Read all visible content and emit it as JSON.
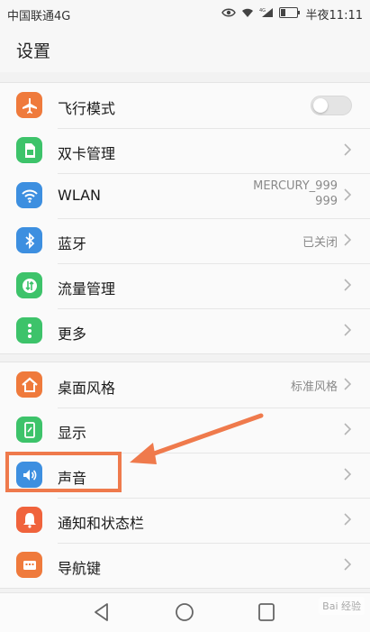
{
  "status_bar": {
    "carrier": "中国联通4G",
    "network": "4G",
    "time": "半夜11:11"
  },
  "header": {
    "title": "设置"
  },
  "groups": [
    {
      "items": [
        {
          "label": "飞行模式",
          "icon": "airplane-icon",
          "icon_color": "#ef7a3c",
          "control": "toggle",
          "toggle_on": false
        },
        {
          "label": "双卡管理",
          "icon": "sim-card-icon",
          "icon_color": "#3dc36a",
          "control": "chevron"
        },
        {
          "label": "WLAN",
          "icon": "wifi-icon",
          "icon_color": "#3d8fe0",
          "value_lines": [
            "MERCURY_999",
            "999"
          ],
          "control": "chevron"
        },
        {
          "label": "蓝牙",
          "icon": "bluetooth-icon",
          "icon_color": "#3d8fe0",
          "value": "已关闭",
          "control": "chevron"
        },
        {
          "label": "流量管理",
          "icon": "data-traffic-icon",
          "icon_color": "#3dc36a",
          "control": "chevron"
        },
        {
          "label": "更多",
          "icon": "more-dots-icon",
          "icon_color": "#3dc36a",
          "control": "chevron"
        }
      ]
    },
    {
      "items": [
        {
          "label": "桌面风格",
          "icon": "home-style-icon",
          "icon_color": "#ef7a3c",
          "value": "标准风格",
          "control": "chevron"
        },
        {
          "label": "显示",
          "icon": "display-icon",
          "icon_color": "#3dc36a",
          "control": "chevron"
        },
        {
          "label": "声音",
          "icon": "sound-icon",
          "icon_color": "#3d8fe0",
          "control": "chevron",
          "highlighted": true
        },
        {
          "label": "通知和状态栏",
          "icon": "bell-icon",
          "icon_color": "#f0633c",
          "control": "chevron"
        },
        {
          "label": "导航键",
          "icon": "navigation-key-icon",
          "icon_color": "#ef7a3c",
          "control": "chevron"
        }
      ]
    }
  ],
  "annotation": {
    "color": "#ef7a4c"
  },
  "nav_bar": {
    "buttons": [
      "back-icon",
      "home-icon",
      "recents-icon"
    ]
  },
  "watermark": "Bai 经验"
}
